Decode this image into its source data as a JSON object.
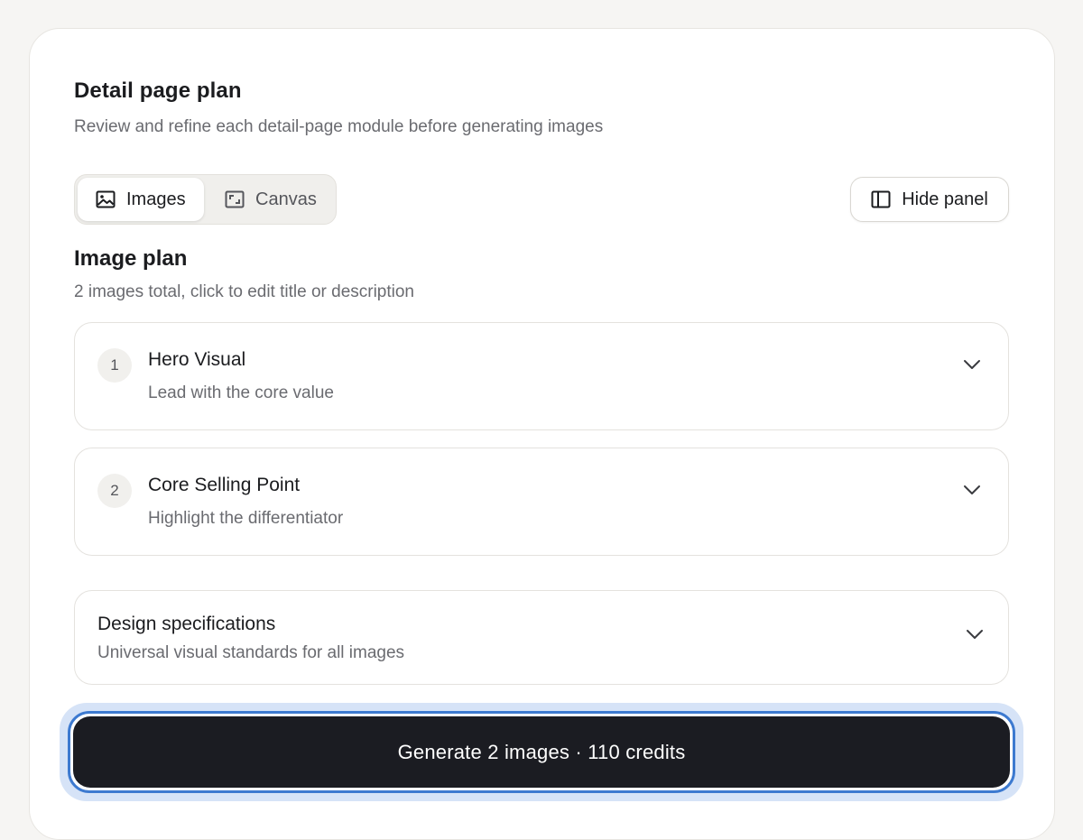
{
  "header": {
    "title": "Detail page plan",
    "subtitle": "Review and refine each detail-page module before generating images"
  },
  "view_toggle": {
    "options": [
      {
        "label": "Images",
        "icon": "image-icon",
        "active": true
      },
      {
        "label": "Canvas",
        "icon": "canvas-icon",
        "active": false
      }
    ]
  },
  "hide_panel": {
    "label": "Hide panel",
    "icon": "sidebar-panel-icon"
  },
  "image_plan": {
    "title": "Image plan",
    "subtitle": "2 images total, click to edit title or description",
    "items": [
      {
        "number": "1",
        "title": "Hero Visual",
        "description": "Lead with the core value"
      },
      {
        "number": "2",
        "title": "Core Selling Point",
        "description": "Highlight the differentiator"
      }
    ]
  },
  "design_specs": {
    "title": "Design specifications",
    "description": "Universal visual standards for all images"
  },
  "generate": {
    "label": "Generate 2 images · 110 credits"
  },
  "colors": {
    "background": "#f6f5f3",
    "card": "#ffffff",
    "primary_button": "#1b1c22",
    "focus_ring": "#3d7ad0",
    "muted_text": "#6a6b70"
  }
}
